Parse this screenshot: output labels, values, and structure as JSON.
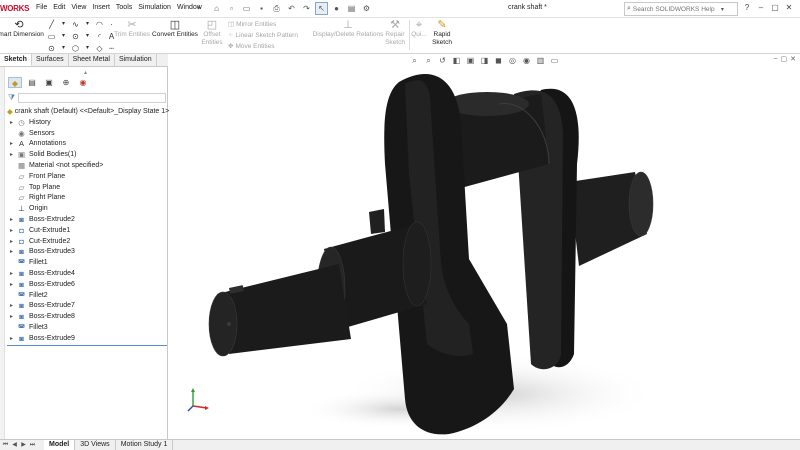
{
  "app": {
    "logo_text": "WORKS",
    "menus": [
      "File",
      "Edit",
      "View",
      "Insert",
      "Tools",
      "Simulation",
      "Window"
    ],
    "document_title": "crank shaft *",
    "search_placeholder": "Search SOLIDWORKS Help"
  },
  "ribbon": {
    "smart_dimension": "Smart Dimension",
    "trim_entities": "Trim Entities",
    "convert_entities": "Convert Entities",
    "offset_entities": [
      "Offset",
      "Entities"
    ],
    "mirror_entities": "Mirror Entities",
    "linear_sketch_pattern": "Linear Sketch Pattern",
    "move_entities": "Move Entities",
    "display_delete_relations": "Display/Delete Relations",
    "repair_sketch": [
      "Repair",
      "Sketch"
    ],
    "quick_snaps": "Qui...",
    "rapid_sketch": [
      "Rapid",
      "Sketch"
    ]
  },
  "panel": {
    "tabs": [
      "Sketch",
      "Surfaces",
      "Sheet Metal",
      "Simulation"
    ],
    "active_tab": "Sketch",
    "tree_root": "crank shaft (Default) <<Default>_Display State 1>",
    "tree_items": [
      {
        "label": "History",
        "expandable": true,
        "icon": "history-icon"
      },
      {
        "label": "Sensors",
        "expandable": false,
        "icon": "sensors-icon"
      },
      {
        "label": "Annotations",
        "expandable": true,
        "icon": "annotations-icon"
      },
      {
        "label": "Solid Bodies(1)",
        "expandable": true,
        "icon": "solid-bodies-icon"
      },
      {
        "label": "Material <not specified>",
        "expandable": false,
        "icon": "material-icon"
      },
      {
        "label": "Front Plane",
        "expandable": false,
        "icon": "plane-icon"
      },
      {
        "label": "Top Plane",
        "expandable": false,
        "icon": "plane-icon"
      },
      {
        "label": "Right Plane",
        "expandable": false,
        "icon": "plane-icon"
      },
      {
        "label": "Origin",
        "expandable": false,
        "icon": "origin-icon"
      },
      {
        "label": "Boss-Extrude2",
        "expandable": true,
        "icon": "boss-extrude-icon"
      },
      {
        "label": "Cut-Extrude1",
        "expandable": true,
        "icon": "cut-extrude-icon"
      },
      {
        "label": "Cut-Extrude2",
        "expandable": true,
        "icon": "cut-extrude-icon"
      },
      {
        "label": "Boss-Extrude3",
        "expandable": true,
        "icon": "boss-extrude-icon"
      },
      {
        "label": "Fillet1",
        "expandable": false,
        "icon": "fillet-icon"
      },
      {
        "label": "Boss-Extrude4",
        "expandable": true,
        "icon": "boss-extrude-icon"
      },
      {
        "label": "Boss-Extrude6",
        "expandable": true,
        "icon": "boss-extrude-icon"
      },
      {
        "label": "Fillet2",
        "expandable": false,
        "icon": "fillet-icon"
      },
      {
        "label": "Boss-Extrude7",
        "expandable": true,
        "icon": "boss-extrude-icon"
      },
      {
        "label": "Boss-Extrude8",
        "expandable": true,
        "icon": "boss-extrude-icon"
      },
      {
        "label": "Fillet3",
        "expandable": false,
        "icon": "fillet-icon"
      },
      {
        "label": "Boss-Extrude9",
        "expandable": true,
        "icon": "boss-extrude-icon"
      }
    ]
  },
  "bottom_tabs": [
    "Model",
    "3D Views",
    "Motion Study 1"
  ],
  "active_bottom_tab": "Model",
  "colors": {
    "accent": "#c8102e",
    "tree_icon_blue": "#4d79b5",
    "part_body": "#1b1b1b",
    "rollback_bar": "#5b8cd6"
  }
}
